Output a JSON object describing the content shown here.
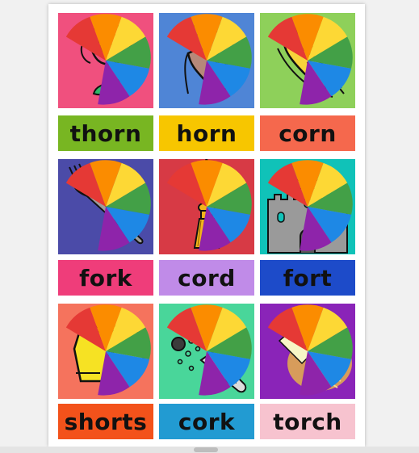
{
  "cards": [
    {
      "word": "thorn",
      "tile_color": "#f0507e",
      "label_color": "#78b622",
      "icon": "rose-icon"
    },
    {
      "word": "horn",
      "tile_color": "#4f85d6",
      "label_color": "#f7c600",
      "icon": "goat-icon"
    },
    {
      "word": "corn",
      "tile_color": "#8ed05a",
      "label_color": "#f5684d",
      "icon": "corn-icon"
    },
    {
      "word": "fork",
      "tile_color": "#4b4ba8",
      "label_color": "#ef3d7a",
      "icon": "fork-icon"
    },
    {
      "word": "cord",
      "tile_color": "#d73a45",
      "label_color": "#c08be8",
      "icon": "tassel-icon"
    },
    {
      "word": "fort",
      "tile_color": "#10c2b8",
      "label_color": "#1d4bc9",
      "icon": "castle-icon"
    },
    {
      "word": "shorts",
      "tile_color": "#f5735d",
      "label_color": "#f3521b",
      "icon": "shorts-icon"
    },
    {
      "word": "cork",
      "tile_color": "#49d69a",
      "label_color": "#229bd2",
      "icon": "bottle-cork-icon"
    },
    {
      "word": "torch",
      "tile_color": "#8a24b8",
      "label_color": "#f7c3cf",
      "icon": "torch-icon"
    }
  ]
}
